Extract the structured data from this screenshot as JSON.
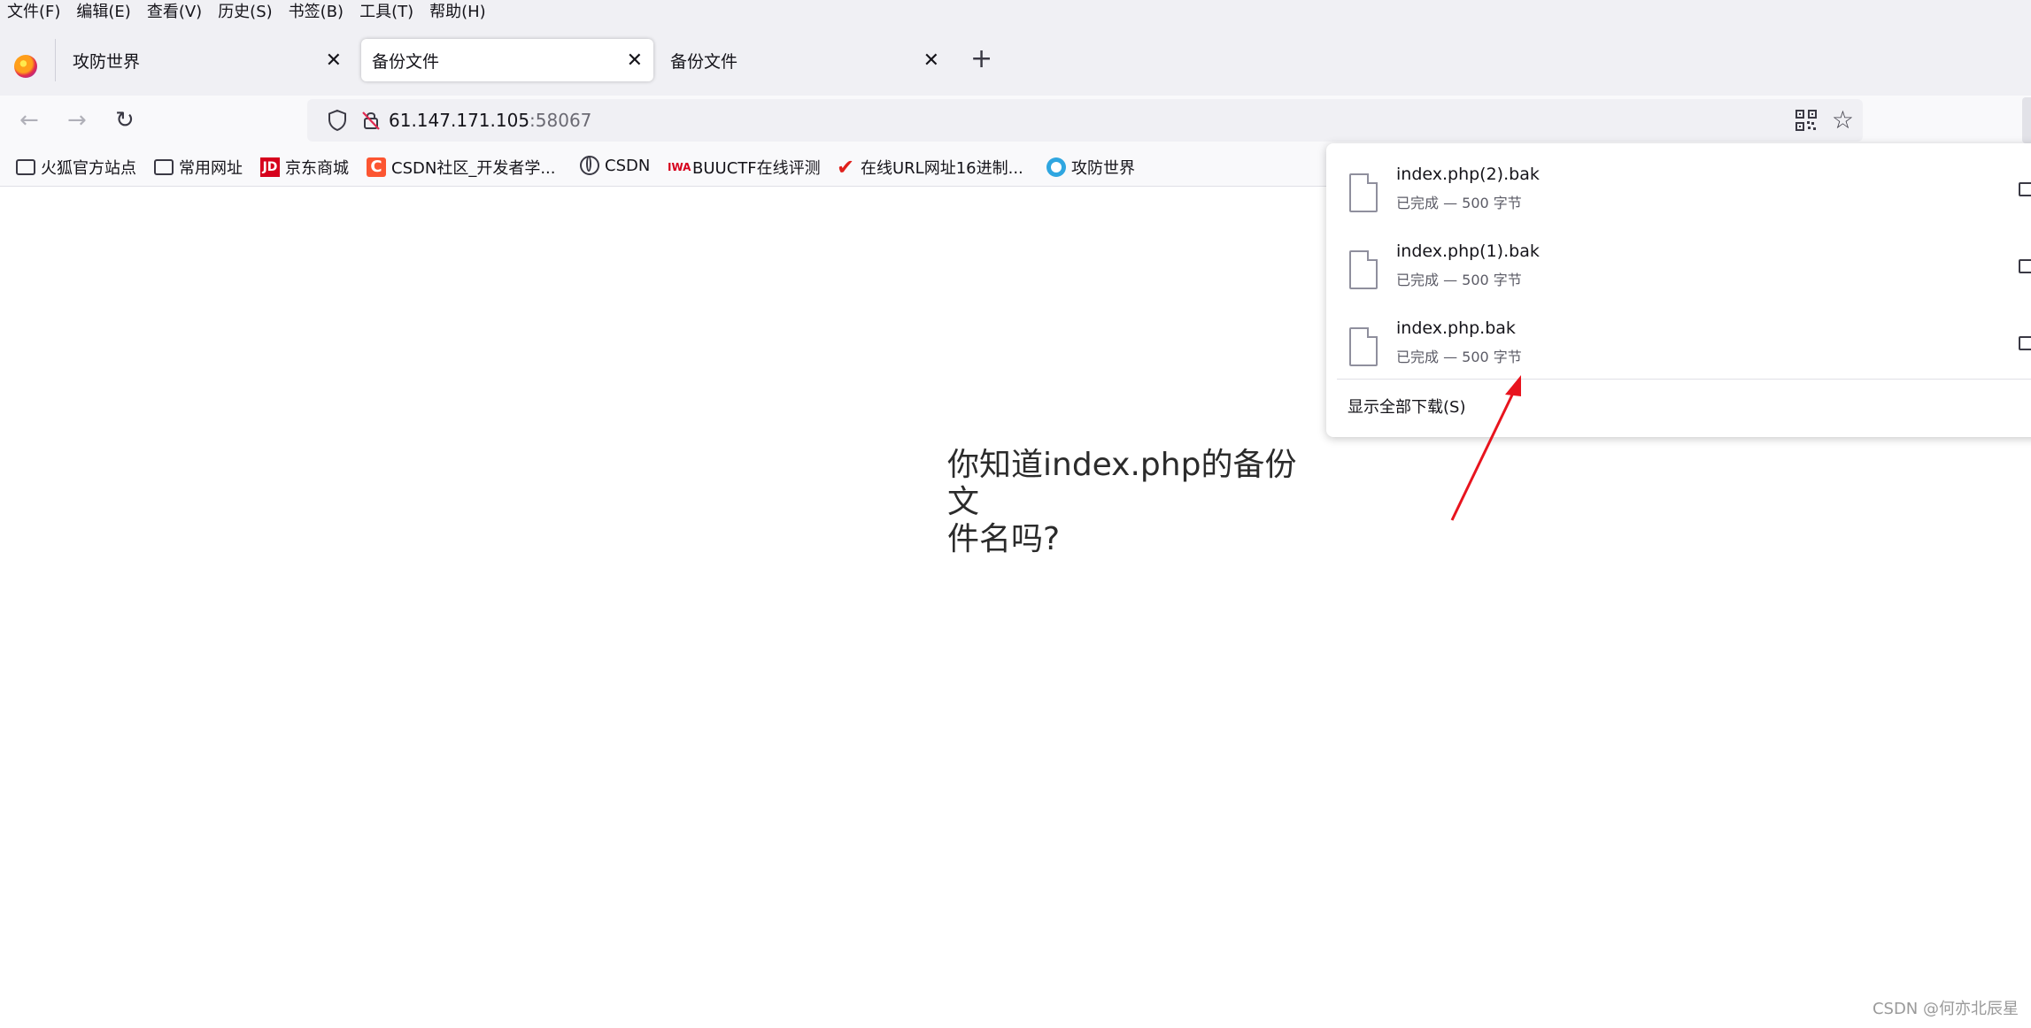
{
  "menu": [
    "文件(F)",
    "编辑(E)",
    "查看(V)",
    "历史(S)",
    "书签(B)",
    "工具(T)",
    "帮助(H)"
  ],
  "tabs": [
    {
      "title": "攻防世界",
      "active": false
    },
    {
      "title": "备份文件",
      "active": true
    },
    {
      "title": "备份文件",
      "active": false
    }
  ],
  "tab_close_glyph": "✕",
  "new_tab_glyph": "+",
  "nav": {
    "back": "←",
    "forward": "→",
    "reload": "↻"
  },
  "url": {
    "host": "61.147.171.105",
    "port": ":58067"
  },
  "bookmarks": [
    {
      "label": "火狐官方站点",
      "icon": "folder-icon"
    },
    {
      "label": "常用网址",
      "icon": "folder-icon"
    },
    {
      "label": "京东商城",
      "icon": "jd-icon",
      "icon_text": "JD"
    },
    {
      "label": "CSDN社区_开发者学...",
      "icon": "csdn-icon",
      "icon_text": "C"
    },
    {
      "label": "CSDN",
      "icon": "globe-icon"
    },
    {
      "label": "BUUCTF在线评测",
      "icon": "buuctf-icon",
      "icon_text": "IWA"
    },
    {
      "label": "在线URL网址16进制...",
      "icon": "checkmark-icon",
      "icon_text": "✔"
    },
    {
      "label": "攻防世界",
      "icon": "gongfang-icon"
    }
  ],
  "downloads": {
    "items": [
      {
        "name": "index.php(2).bak",
        "status": "已完成 — 500 字节"
      },
      {
        "name": "index.php(1).bak",
        "status": "已完成 — 500 字节"
      },
      {
        "name": "index.php.bak",
        "status": "已完成 — 500 字节"
      }
    ],
    "show_all": "显示全部下载(S)"
  },
  "page": {
    "text_line1": "你知道index.php的备份文",
    "text_line2": "件名吗?"
  },
  "colors": {
    "annotation_arrow": "#e8141e",
    "chrome_bg": "#f0f0f4"
  },
  "watermark": "CSDN @何亦北辰星"
}
